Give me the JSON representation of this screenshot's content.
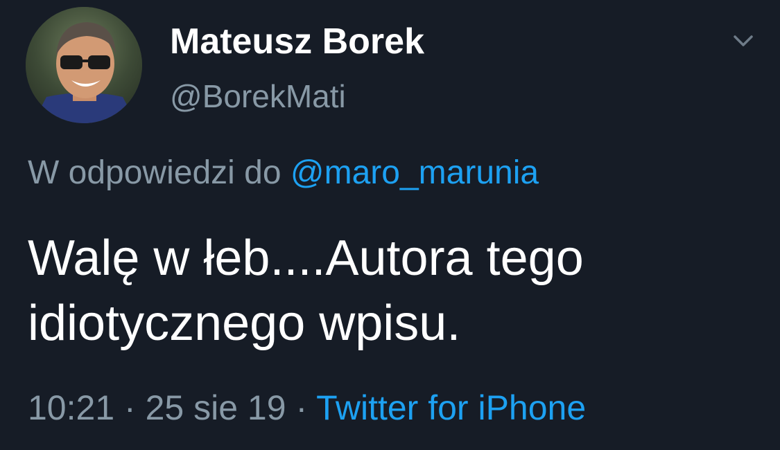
{
  "user": {
    "display_name": "Mateusz Borek",
    "handle": "@BorekMati"
  },
  "icons": {
    "menu": "chevron-down-icon"
  },
  "reply": {
    "prefix": "W odpowiedzi do",
    "mention": "@maro_marunia"
  },
  "tweet": {
    "lines": [
      "Walę w łeb....Autora tego",
      "idiotycznego wpisu."
    ]
  },
  "meta": {
    "time": "10:21",
    "separator": "·",
    "date": "25 sie 19",
    "source": "Twitter for iPhone"
  },
  "colors": {
    "background": "#161c26",
    "secondary_text": "#8899a6",
    "link": "#1da1f2",
    "primary_text": "#ffffff"
  }
}
